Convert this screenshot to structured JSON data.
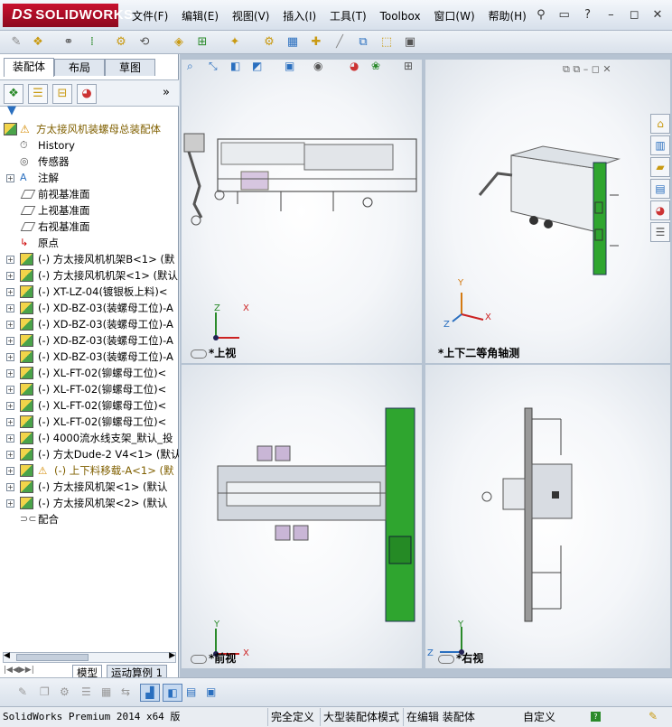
{
  "app": {
    "logo_text": "SOLIDWORKS",
    "logo_prefix": "DS"
  },
  "menu": {
    "items": [
      {
        "label": "文件(F)"
      },
      {
        "label": "编辑(E)"
      },
      {
        "label": "视图(V)"
      },
      {
        "label": "插入(I)"
      },
      {
        "label": "工具(T)"
      },
      {
        "label": "Toolbox"
      },
      {
        "label": "窗口(W)"
      },
      {
        "label": "帮助(H)"
      }
    ]
  },
  "feature_manager": {
    "tabs": [
      {
        "label": "装配体"
      },
      {
        "label": "布局"
      },
      {
        "label": "草图"
      }
    ],
    "root": {
      "label": "方太接风机装螺母总装配体",
      "warning": true
    },
    "tree": [
      {
        "label": "History",
        "icon": "history-icon",
        "expand": false
      },
      {
        "label": "传感器",
        "icon": "sensor-icon",
        "expand": false
      },
      {
        "label": "注解",
        "icon": "annotation-icon",
        "expand": true
      },
      {
        "label": "前视基准面",
        "icon": "plane-icon",
        "expand": false
      },
      {
        "label": "上视基准面",
        "icon": "plane-icon",
        "expand": false
      },
      {
        "label": "右视基准面",
        "icon": "plane-icon",
        "expand": false
      },
      {
        "label": "原点",
        "icon": "origin-icon",
        "expand": false
      },
      {
        "label": "(-) 方太接风机机架B<1> (默",
        "icon": "assembly-icon",
        "expand": true
      },
      {
        "label": "(-) 方太接风机机架<1> (默认",
        "icon": "assembly-icon",
        "expand": true
      },
      {
        "label": "(-) XT-LZ-04(镀银板上料)<",
        "icon": "assembly-icon",
        "expand": true
      },
      {
        "label": "(-) XD-BZ-03(装螺母工位)-A",
        "icon": "assembly-icon",
        "expand": true
      },
      {
        "label": "(-) XD-BZ-03(装螺母工位)-A",
        "icon": "assembly-icon",
        "expand": true
      },
      {
        "label": "(-) XD-BZ-03(装螺母工位)-A",
        "icon": "assembly-icon",
        "expand": true
      },
      {
        "label": "(-) XD-BZ-03(装螺母工位)-A",
        "icon": "assembly-icon",
        "expand": true
      },
      {
        "label": "(-) XL-FT-02(铆螺母工位)<",
        "icon": "assembly-icon",
        "expand": true
      },
      {
        "label": "(-) XL-FT-02(铆螺母工位)<",
        "icon": "assembly-icon",
        "expand": true
      },
      {
        "label": "(-) XL-FT-02(铆螺母工位)<",
        "icon": "assembly-icon",
        "expand": true
      },
      {
        "label": "(-) XL-FT-02(铆螺母工位)<",
        "icon": "assembly-icon",
        "expand": true
      },
      {
        "label": "(-) 4000流水线支架_默认_投",
        "icon": "assembly-icon",
        "expand": true
      },
      {
        "label": "(-) 方太Dude-2 V4<1> (默认",
        "icon": "assembly-icon",
        "expand": true
      },
      {
        "label": "(-) 上下料移载-A<1> (默",
        "icon": "assembly-icon",
        "expand": true,
        "warning": true
      },
      {
        "label": "(-) 方太接风机架<1> (默认",
        "icon": "assembly-icon",
        "expand": true
      },
      {
        "label": "(-) 方太接风机架<2> (默认",
        "icon": "assembly-icon",
        "expand": true
      },
      {
        "label": "配合",
        "icon": "mates-icon",
        "expand": false
      }
    ],
    "bottom_tabs": [
      {
        "label": "模型"
      },
      {
        "label": "运动算例 1"
      }
    ]
  },
  "viewports": [
    {
      "label": "*上视",
      "axes": [
        "X",
        "Z"
      ]
    },
    {
      "label": "*上下二等角轴测",
      "axes": [
        "Y",
        "X",
        "Z"
      ]
    },
    {
      "label": "*前视",
      "axes": [
        "Y",
        "X"
      ]
    },
    {
      "label": "*右视",
      "axes": [
        "Y",
        "Z"
      ]
    }
  ],
  "status": {
    "version": "SolidWorks Premium 2014 x64 版",
    "fully_defined": "完全定义",
    "large_assembly": "大型装配体模式",
    "editing": "在编辑 装配体",
    "custom": "自定义"
  },
  "colors": {
    "logo_red": "#c8102e",
    "model_green": "#2fa52f",
    "model_gray": "#7b8391",
    "warning": "#d48a00"
  }
}
